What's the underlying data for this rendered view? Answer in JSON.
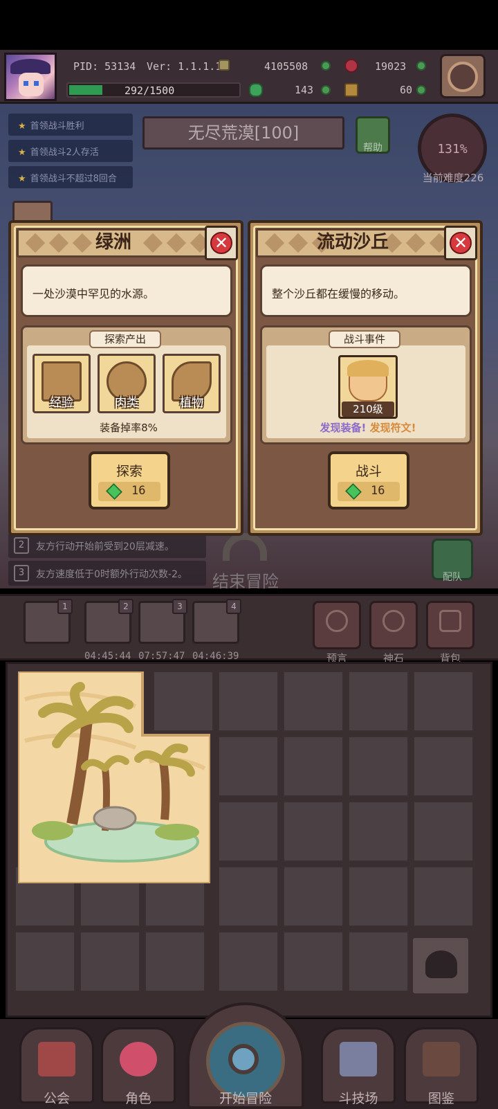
{
  "hud": {
    "pid": "PID: 53134",
    "version": "Ver: 1.1.1.10",
    "gold": "4105508",
    "gems": "19023",
    "stamina": "292/1500",
    "stamina_fraction": 0.195,
    "clover": "143",
    "ore": "60"
  },
  "quests": [
    "首领战斗胜利",
    "首领战斗2人存活",
    "首领战斗不超过8回合"
  ],
  "stage": {
    "name": "无尽荒漠[100]",
    "help": "帮助",
    "difficulty_pct": "131%",
    "difficulty": "当前难度226"
  },
  "buffs": [
    {
      "n": "2",
      "text": "友方行动开始前受到20层减速。"
    },
    {
      "n": "3",
      "text": "友方速度低于0时额外行动次数-2。"
    }
  ],
  "end_adventure": "结束冒险",
  "team": "配队",
  "card_left": {
    "title": "绿洲",
    "close": "✕",
    "desc": "一处沙漠中罕见的水源。",
    "section_title": "探索产出",
    "rewards": [
      "经验",
      "肉类",
      "植物"
    ],
    "drop_rate": "装备掉率8%",
    "action": "探索",
    "cost": "16"
  },
  "card_right": {
    "title": "流动沙丘",
    "close": "✕",
    "desc": "整个沙丘都在缓慢的移动。",
    "section_title": "战斗事件",
    "enemy_level": "210级",
    "find_equipment": "发现装备!",
    "find_rune": "发现符文!",
    "action": "战斗",
    "cost": "16"
  },
  "slots": [
    {
      "n": "1",
      "timer": ""
    },
    {
      "n": "2",
      "timer": "04:45:44"
    },
    {
      "n": "3",
      "timer": "07:57:47"
    },
    {
      "n": "4",
      "timer": "04:46:39"
    }
  ],
  "side_buttons": [
    "预言",
    "神石",
    "背包"
  ],
  "nav": {
    "guild": "公会",
    "character": "角色",
    "start": "开始冒险",
    "arena": "斗技场",
    "codex": "图鉴"
  },
  "colors": {
    "card_bg": "#b58f5e",
    "close_red": "#d63a3e",
    "gem_green": "#48c25a",
    "find_equipment": "#8c6ac8",
    "find_rune": "#d68a3a"
  }
}
